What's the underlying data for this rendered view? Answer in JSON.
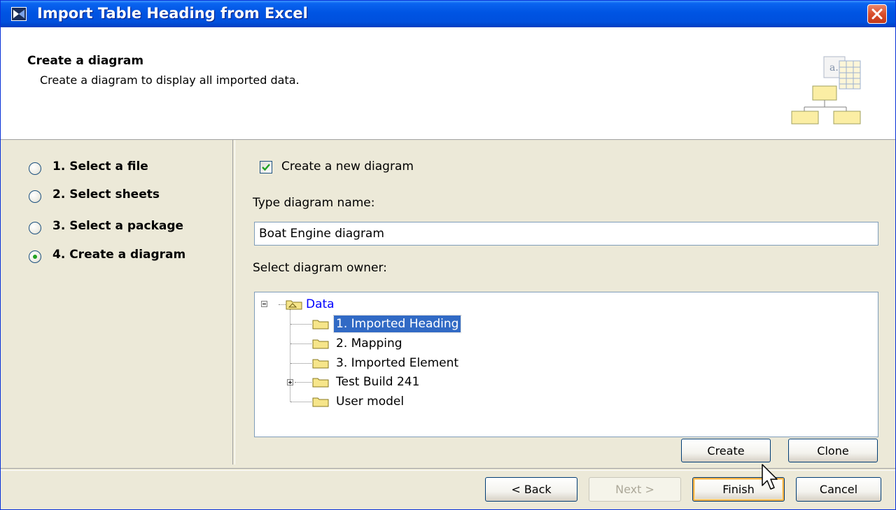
{
  "window": {
    "title": "Import Table Heading from Excel",
    "close_label": "Close"
  },
  "header": {
    "title": "Create a diagram",
    "description": "Create a diagram to display all imported data."
  },
  "steps": [
    {
      "label": "1. Select a file",
      "selected": false
    },
    {
      "label": "2. Select sheets",
      "selected": false
    },
    {
      "label": "3. Select a package",
      "selected": false
    },
    {
      "label": "4. Create a diagram",
      "selected": true
    }
  ],
  "form": {
    "create_new_checkbox": {
      "label": "Create a new diagram",
      "checked": true
    },
    "name_label": "Type diagram name:",
    "name_value": "Boat Engine diagram",
    "owner_label": "Select diagram owner:"
  },
  "tree": {
    "root": {
      "label": "Data",
      "expanded": true
    },
    "children": [
      {
        "label": "1. Imported Heading",
        "selected": true,
        "expandable": false
      },
      {
        "label": "2. Mapping",
        "selected": false,
        "expandable": false
      },
      {
        "label": "3. Imported Element",
        "selected": false,
        "expandable": false
      },
      {
        "label": "Test Build 241",
        "selected": false,
        "expandable": true
      },
      {
        "label": "User model",
        "selected": false,
        "expandable": false
      }
    ]
  },
  "tree_buttons": {
    "create": "Create",
    "clone": "Clone"
  },
  "footer": {
    "back": "< Back",
    "next": "Next >",
    "finish": "Finish",
    "cancel": "Cancel"
  },
  "colors": {
    "titlebar": "#0054e3",
    "dialog_bg": "#ece9d8",
    "selection": "#316ac5",
    "root_link": "#0000ff"
  }
}
